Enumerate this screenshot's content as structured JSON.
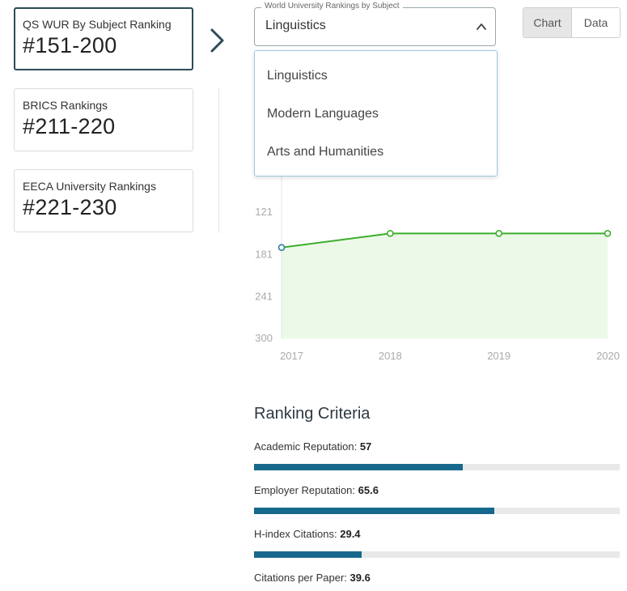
{
  "rank_cards": [
    {
      "label": "QS WUR By Subject Ranking",
      "value": "#151-200"
    },
    {
      "label": "BRICS Rankings",
      "value": "#211-220"
    },
    {
      "label": "EECA University Rankings",
      "value": "#221-230"
    }
  ],
  "subject_select": {
    "legend": "World University Rankings by Subject",
    "value": "Linguistics",
    "options": [
      "Linguistics",
      "Modern Languages",
      "Arts and Humanities"
    ]
  },
  "view_toggle": {
    "chart": "Chart",
    "data": "Data",
    "active": "Chart"
  },
  "chart_data": {
    "type": "area",
    "x": [
      "2017",
      "2018",
      "2019",
      "2020"
    ],
    "values": [
      171,
      151,
      151,
      151
    ],
    "ylim": [
      300,
      61
    ],
    "y_ticks": [
      "121",
      "181",
      "241",
      "300"
    ],
    "y_axis_reversed": true,
    "line_color": "#3cae2c",
    "fill_color": "#ecf9e8",
    "marker_color_first": "#2a7fa0",
    "marker_color": "#3cae2c",
    "grid": false
  },
  "criteria": {
    "title": "Ranking Criteria",
    "items": [
      {
        "label": "Academic Reputation:",
        "value": "57",
        "fraction": 0.57
      },
      {
        "label": "Employer Reputation:",
        "value": "65.6",
        "fraction": 0.656
      },
      {
        "label": "H-index Citations:",
        "value": "29.4",
        "fraction": 0.294
      },
      {
        "label": "Citations per Paper:",
        "value": "39.6",
        "fraction": 0.396
      }
    ],
    "bar_color": "#16698c"
  }
}
